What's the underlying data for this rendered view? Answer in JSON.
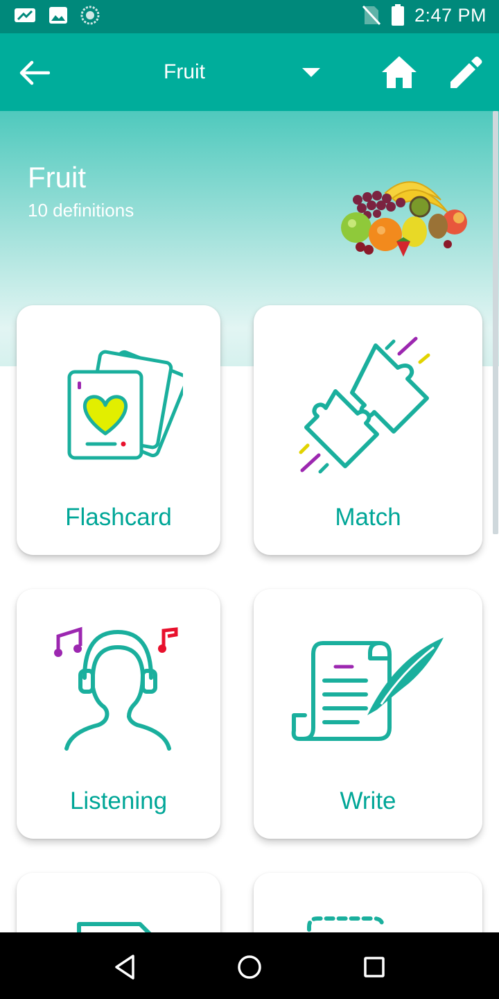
{
  "status_bar": {
    "time": "2:47 PM",
    "icons": [
      "sim-icon",
      "image-icon",
      "sync-icon",
      "no-sim-icon",
      "battery-icon"
    ]
  },
  "app_bar": {
    "title": "Fruit",
    "icons": [
      "back-arrow-icon",
      "dropdown-icon",
      "home-icon",
      "edit-icon"
    ]
  },
  "header": {
    "title": "Fruit",
    "subtitle": "10 definitions",
    "image": "fruit-basket-image"
  },
  "modes": [
    {
      "label": "Flashcard",
      "icon": "flashcard-icon"
    },
    {
      "label": "Match",
      "icon": "puzzle-icon"
    },
    {
      "label": "Listening",
      "icon": "listening-icon"
    },
    {
      "label": "Write",
      "icon": "write-icon"
    },
    {
      "label": "",
      "icon": "document-icon"
    },
    {
      "label": "",
      "icon": "dashed-box-icon"
    }
  ],
  "colors": {
    "primary": "#00ad9b",
    "status_bar": "#00897b",
    "accent_text": "#00a697",
    "icon_teal": "#1aaf9d",
    "icon_purple": "#9c27b0",
    "icon_yellow": "#e2d300",
    "icon_red": "#e8112d"
  },
  "nav_bar": {
    "icons": [
      "nav-back-icon",
      "nav-home-icon",
      "nav-recents-icon"
    ]
  }
}
